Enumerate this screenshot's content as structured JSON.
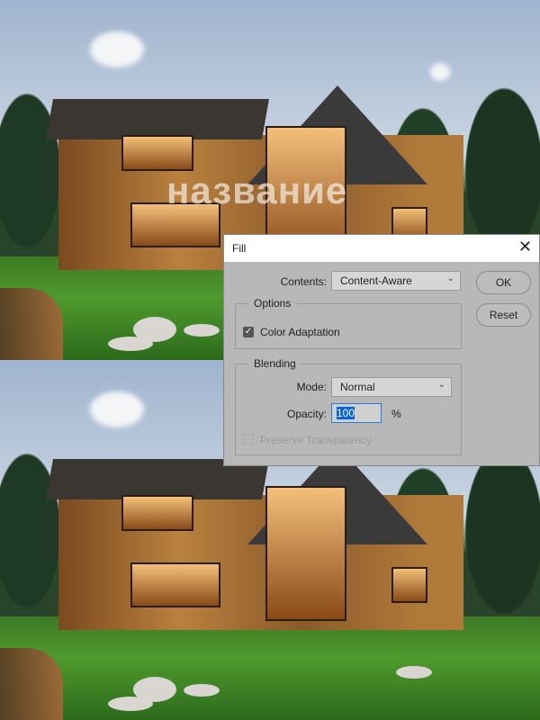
{
  "watermark": "название",
  "dialog": {
    "title": "Fill",
    "contents_label": "Contents:",
    "contents_value": "Content-Aware",
    "ok_label": "OK",
    "reset_label": "Reset",
    "options_label": "Options",
    "color_adaptation_label": "Color Adaptation",
    "color_adaptation_checked": true,
    "blending_label": "Blending",
    "mode_label": "Mode:",
    "mode_value": "Normal",
    "opacity_label": "Opacity:",
    "opacity_value": "100",
    "opacity_unit": "%",
    "preserve_transparency_label": "Preserve Transparency",
    "preserve_transparency_checked": false,
    "preserve_transparency_enabled": false
  },
  "colors": {
    "dialog_bg": "#b8b8b8",
    "selection": "#0a64d8"
  }
}
